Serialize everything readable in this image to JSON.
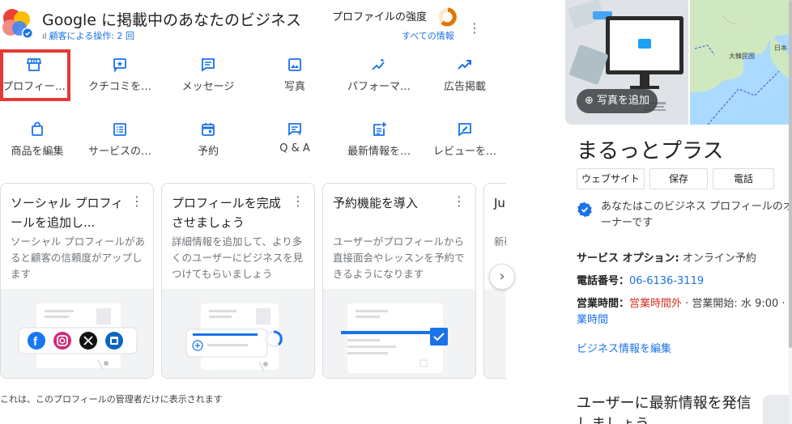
{
  "header": {
    "title": "Google に掲載中のあなたのビジネス",
    "customer_actions": "顧客による操作: 2 回",
    "profile_strength": "プロファイルの強度",
    "all_info": "すべての情報"
  },
  "grid": {
    "row1": [
      {
        "label": "プロフィー…",
        "icon": "storefront-icon"
      },
      {
        "label": "クチコミを…",
        "icon": "review-icon"
      },
      {
        "label": "メッセージ",
        "icon": "message-icon"
      },
      {
        "label": "写真",
        "icon": "photo-icon"
      },
      {
        "label": "パフォーマ…",
        "icon": "sparkle-chart-icon"
      },
      {
        "label": "広告掲載",
        "icon": "trending-up-icon"
      }
    ],
    "row2": [
      {
        "label": "商品を編集",
        "icon": "shopping-bag-icon"
      },
      {
        "label": "サービスの…",
        "icon": "list-icon"
      },
      {
        "label": "予約",
        "icon": "calendar-icon"
      },
      {
        "label": "Q & A",
        "icon": "qa-icon"
      },
      {
        "label": "最新情報を…",
        "icon": "post-add-icon"
      },
      {
        "label": "レビューを…",
        "icon": "rate-review-icon"
      }
    ]
  },
  "cards": [
    {
      "title": "ソーシャル プロフィールを追加し...",
      "desc": "ソーシャル プロフィールがあると顧客の信頼度がアップします"
    },
    {
      "title": "プロフィールを完成させましょう",
      "desc": "詳細情報を追加して、より多くのユーザーにビジネスを見つけてもらいましょう"
    },
    {
      "title": "予約機能を導入",
      "desc": "ユーザーがプロフィールから直接面会やレッスンを予約できるようになります"
    },
    {
      "title": "Juン",
      "desc": "新確"
    }
  ],
  "footnote": "これは、このプロフィールの管理者だけに表示されます",
  "side": {
    "add_photo": "写真を追加",
    "map_label": "大韓民国",
    "map_label2": "日本",
    "business_name": "まるっとプラス",
    "buttons": [
      "ウェブサイト",
      "保存",
      "電話"
    ],
    "verified_text": "あなたはこのビジネス プロフィールのオーナーです",
    "service_label": "サービス オプション:",
    "service_value": "オンライン予約",
    "phone_label": "電話番号：",
    "phone_value": "06-6136-3119",
    "hours_label": "営業時間：",
    "hours_status": "営業時間外",
    "hours_next": "· 営業開始: 水 9:00 ·",
    "hours_more": "業時間",
    "edit_link": "ビジネス情報を編集",
    "post_title": "ユーザーに最新情報を発信",
    "post_title2": "しましょう"
  },
  "colors": {
    "accent": "#1a73e8",
    "selection": "#e53935",
    "hours_closed": "#d93025",
    "strength_ring": "#e37400"
  }
}
